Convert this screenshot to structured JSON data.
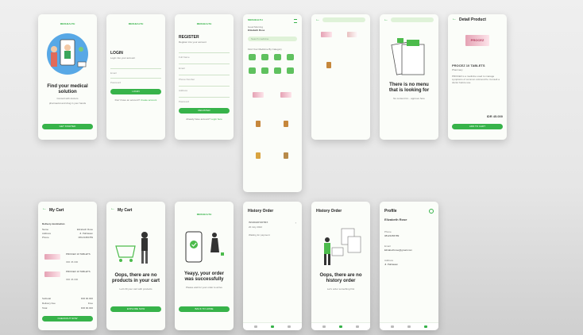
{
  "brand": "MEDHEALTH",
  "welcome": {
    "title": "Find your medical solution",
    "sub_1": "Consult with doctors",
    "sub_2": "pharmacist and drug in your hands",
    "button": "GET STARTED"
  },
  "login": {
    "title": "LOGIN",
    "sub": "Login into your account",
    "email": "Email",
    "password": "Password",
    "button": "LOGIN",
    "register_prompt": "Don't have an account?",
    "register_link": "Create account"
  },
  "register": {
    "title": "REGISTER",
    "sub": "Register into your account",
    "fields": [
      "Full Name",
      "Email",
      "Phone Number",
      "Address",
      "Password"
    ],
    "button": "REGISTER",
    "login_prompt": "Already have account?",
    "login_link": "Login here"
  },
  "home": {
    "greeting": "Good Morning",
    "user": "Elizabeth Rose",
    "search_placeholder": "Search medicine",
    "section": "Find Your Medicine By Category",
    "categories": [
      "Drugs",
      "Herbal",
      "Vitamin",
      "Supplement",
      "Medical",
      "Baby",
      "Others",
      "Sport"
    ]
  },
  "search_empty": {
    "title": "There is no menu that is looking for",
    "sub": "No content for... approve here"
  },
  "detail": {
    "header": "Detail Product",
    "product_label": "PROCEZ",
    "name": "PROCEZ 10 TABLETS",
    "category": "Pharmacy",
    "description": "PROCEZ is a medicine used to manage symptoms of common cold and flu. Consult a doctor before use.",
    "price": "IDR 45.000",
    "button": "ADD TO CART"
  },
  "cart": {
    "header": "My Cart",
    "delivery": "Delivery destination",
    "fields": [
      {
        "label": "Name",
        "value": "Elizabeth Rose"
      },
      {
        "label": "Address",
        "value": "Jl. Pahlawan"
      },
      {
        "label": "Phone",
        "value": "08123456789"
      }
    ],
    "items": [
      {
        "name": "PROCEZ 10 TABLETS",
        "price": "IDR 45.000"
      },
      {
        "name": "PROCEZ 10 TABLETS",
        "price": "IDR 45.000"
      }
    ],
    "summary": [
      {
        "label": "Subtotal",
        "value": "IDR 90.000"
      },
      {
        "label": "Delivery Fee",
        "value": "Free"
      },
      {
        "label": "Total",
        "value": "IDR 90.000"
      }
    ],
    "button": "CHECKOUT NOW"
  },
  "cart_empty": {
    "header": "My Cart",
    "title": "Oops, there are no products in your cart",
    "sub": "Let's fill your cart with products",
    "button": "EXPLORE NOW"
  },
  "success": {
    "title": "Yeayy, your order was successfully",
    "sub": "Please wait for your order to arrive",
    "button": "BACK TO HOME"
  },
  "history": {
    "header": "History Order",
    "order_id": "INV20220720TRX",
    "date": "20 July 2022",
    "status": "Waiting for payment"
  },
  "history_empty": {
    "header": "History Order",
    "title": "Oops, there are no history order",
    "sub": "Let's order something first"
  },
  "profile": {
    "header": "Profile",
    "name": "Elizabeth Rose",
    "phone_label": "Phone",
    "phone": "08123456789",
    "email_label": "Email",
    "email": "Elizabethrose@gmail.com",
    "address_label": "Address",
    "address": "Jl. Pahlawan"
  }
}
